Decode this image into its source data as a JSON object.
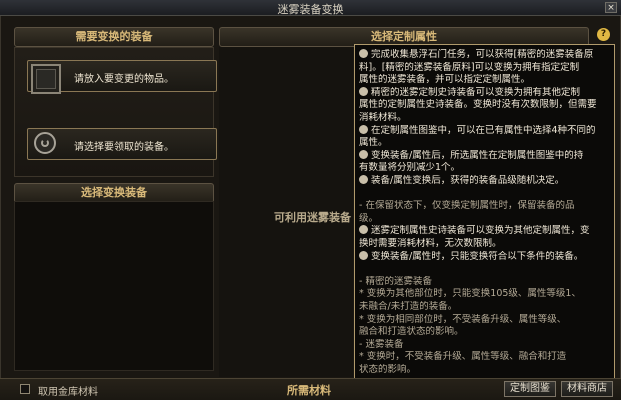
{
  "window": {
    "title": "迷雾装备变换",
    "close_label": "×"
  },
  "left": {
    "section_title": "需要变换的装备",
    "slot1_text": "请放入要变更的物品。",
    "slot2_text": "请选择要领取的装备。",
    "list_title": "选择变换装备"
  },
  "middle": {
    "section_title": "选择定制属性",
    "placeholder": "可利用迷雾装备"
  },
  "help": {
    "button_label": "?",
    "lines": [
      {
        "text": "完成收集悬浮石门任务，可以获得[精密的迷雾装备原",
        "bullet": true
      },
      {
        "text": "料]。[精密的迷雾装备原料]可以变换为拥有指定定制",
        "bullet": false
      },
      {
        "text": "属性的迷雾装备，并可以指定定制属性。",
        "bullet": false
      },
      {
        "text": "精密的迷雾定制史诗装备可以变换为拥有其他定制",
        "bullet": true
      },
      {
        "text": "属性的定制属性史诗装备。变换时没有次数限制，但需要",
        "bullet": false
      },
      {
        "text": "消耗材料。",
        "bullet": false
      },
      {
        "text": "在定制属性图鉴中，可以在已有属性中选择4种不同的",
        "bullet": true
      },
      {
        "text": "属性。",
        "bullet": false
      },
      {
        "text": "变换装备/属性后，所选属性在定制属性图鉴中的持",
        "bullet": true
      },
      {
        "text": "有数量将分别减少1个。",
        "bullet": false
      },
      {
        "text": "装备/属性变换后，获得的装备品级随机决定。",
        "bullet": true
      },
      {
        "text": "",
        "bullet": false
      },
      {
        "text": "- 在保留状态下，仅变换定制属性时，保留装备的品",
        "bullet": false,
        "dim": true
      },
      {
        "text": "级。",
        "bullet": false,
        "dim": true
      },
      {
        "text": "迷雾定制属性史诗装备可以变换为其他定制属性，变",
        "bullet": true
      },
      {
        "text": "换时需要消耗材料，无次数限制。",
        "bullet": false
      },
      {
        "text": "变换装备/属性时，只能变换符合以下条件的装备。",
        "bullet": true
      },
      {
        "text": "",
        "bullet": false
      },
      {
        "text": "- 精密的迷雾装备",
        "bullet": false,
        "dim": true
      },
      {
        "text": "  * 变换为其他部位时，只能变换105级、属性等级1、",
        "bullet": false,
        "dim": true
      },
      {
        "text": "  未融合/未打造的装备。",
        "bullet": false,
        "dim": true
      },
      {
        "text": "  * 变换为相同部位时，不受装备升级、属性等级、",
        "bullet": false,
        "dim": true
      },
      {
        "text": "  融合和打造状态的影响。",
        "bullet": false,
        "dim": true
      },
      {
        "text": "- 迷雾装备",
        "bullet": false,
        "dim": true
      },
      {
        "text": "  * 变换时，不受装备升级、属性等级、融合和打造",
        "bullet": false,
        "dim": true
      },
      {
        "text": "  状态的影响。",
        "bullet": false,
        "dim": true
      }
    ]
  },
  "bottom": {
    "checkbox_label": "取用金库材料",
    "materials_label": "所需材料",
    "btn_codex": "定制图鉴",
    "btn_shop": "材料商店"
  },
  "colors": {
    "accent": "#e7b33a",
    "header_text": "#d8b979",
    "panel_border": "#b09a6c"
  }
}
